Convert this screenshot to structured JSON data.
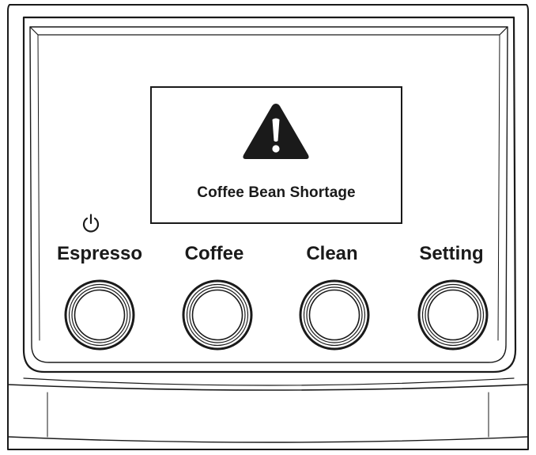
{
  "display": {
    "icon": "warning-triangle-icon",
    "message": "Coffee Bean Shortage"
  },
  "power_icon": "power-icon",
  "buttons": [
    {
      "label": "Espresso",
      "icon": "knob-icon"
    },
    {
      "label": "Coffee",
      "icon": "knob-icon"
    },
    {
      "label": "Clean",
      "icon": "knob-icon"
    },
    {
      "label": "Setting",
      "icon": "knob-icon"
    }
  ],
  "colors": {
    "line": "#1a1a1a",
    "background": "#ffffff"
  }
}
